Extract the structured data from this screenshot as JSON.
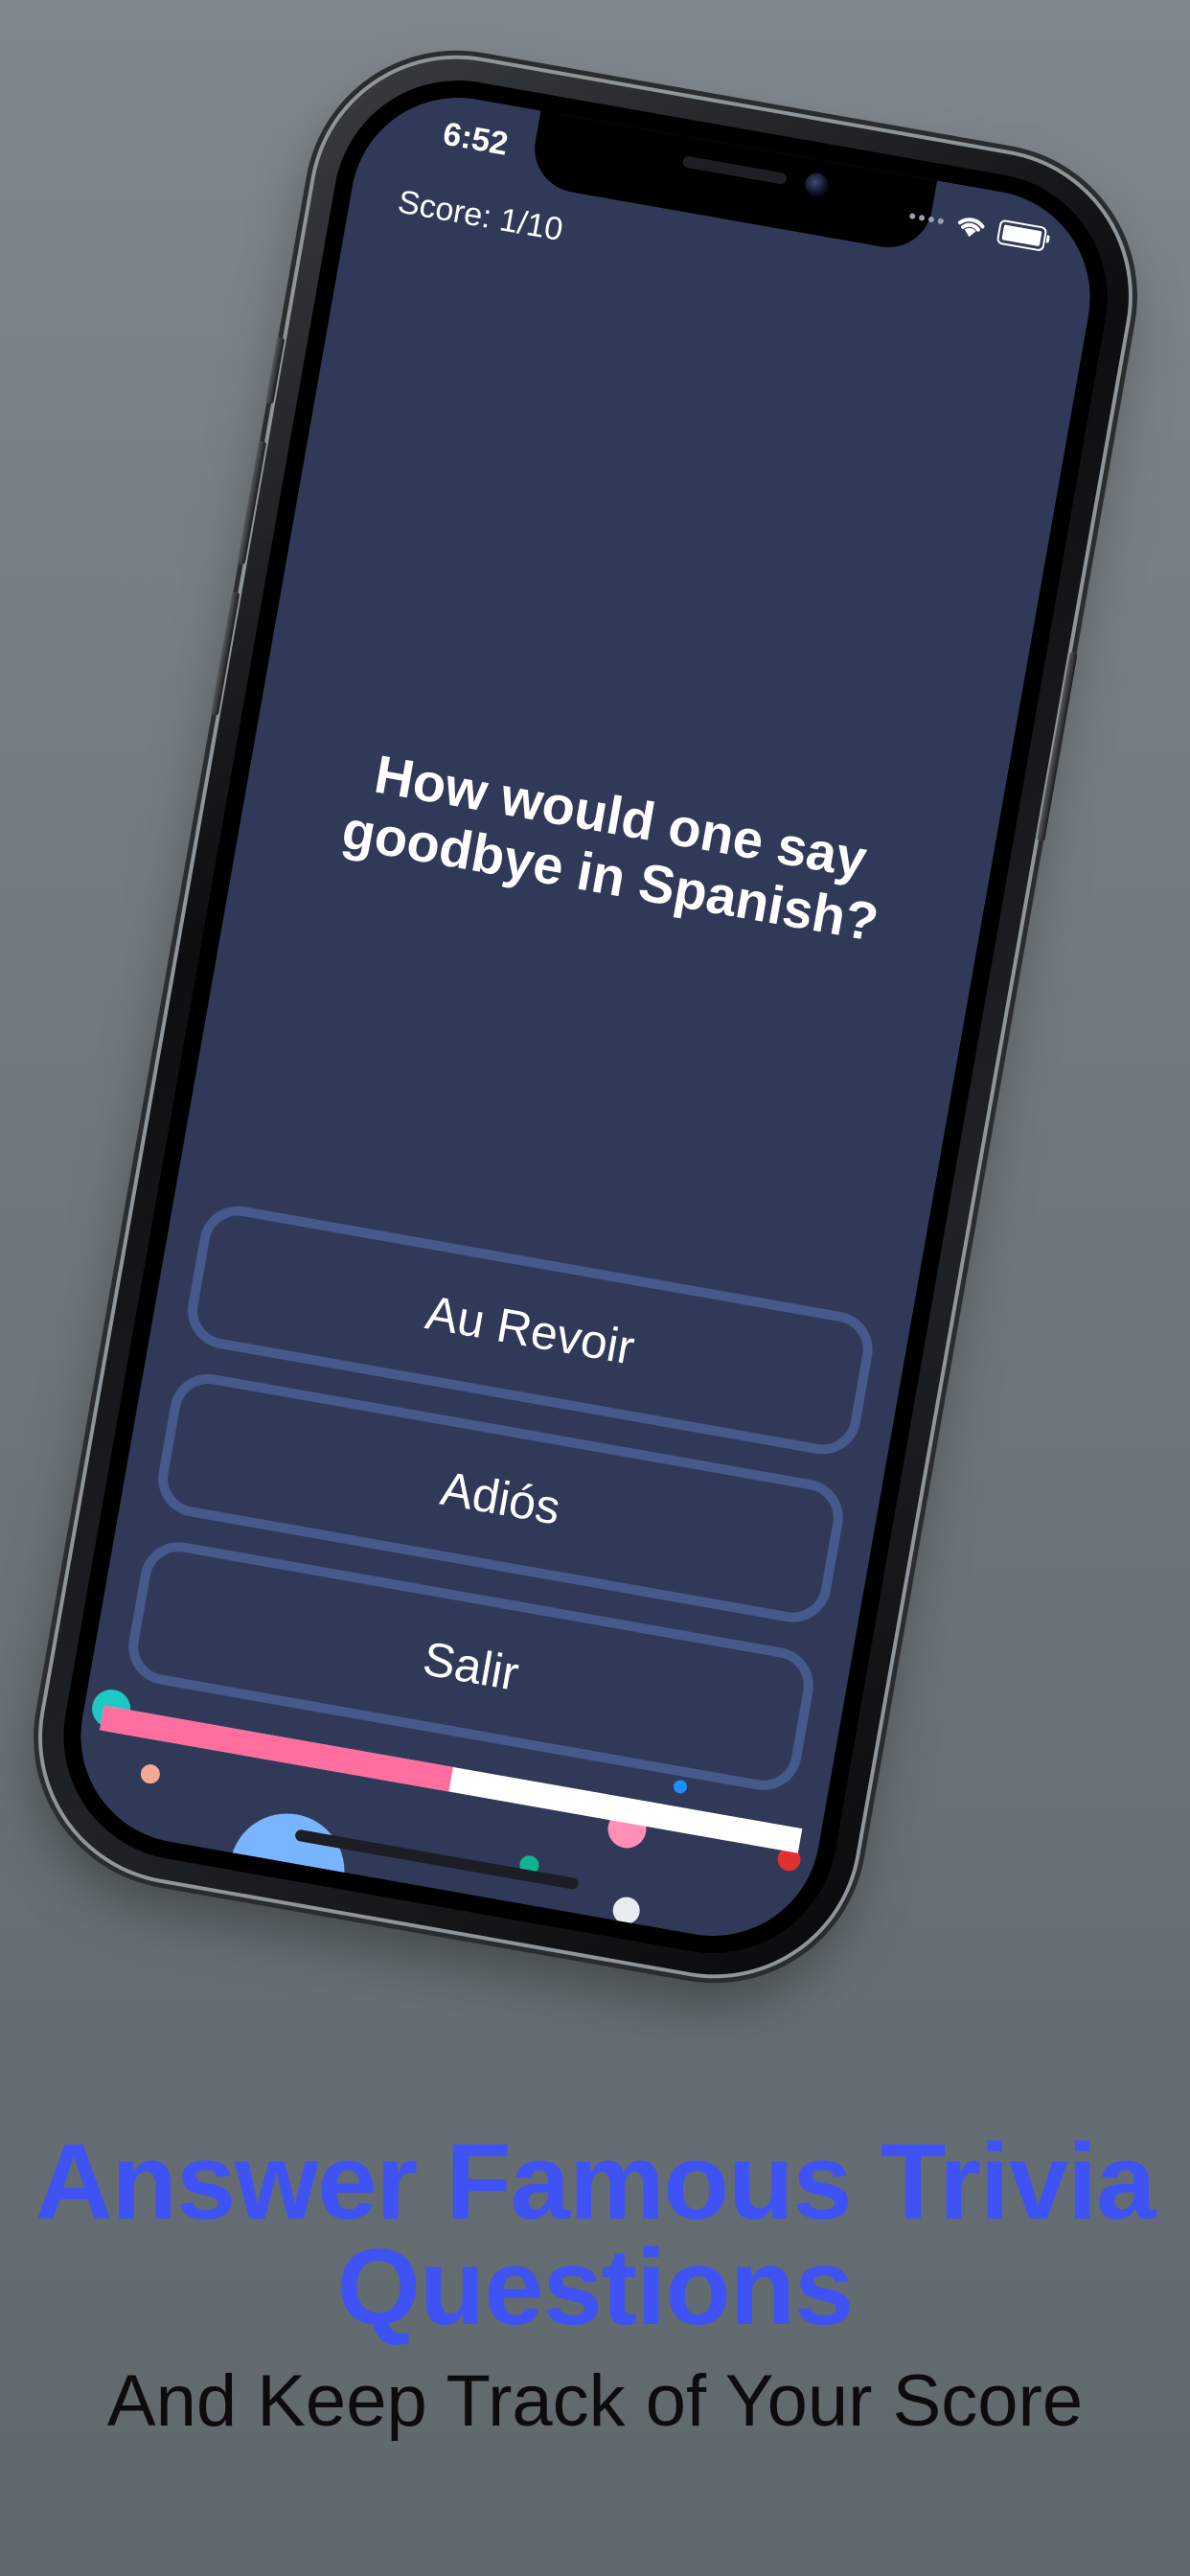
{
  "status_bar": {
    "time": "6:52",
    "icons": [
      "cellular-signal-icon",
      "wifi-icon",
      "battery-icon"
    ]
  },
  "game": {
    "score_label": "Score: 1/10",
    "question": "How would one say goodbye in Spanish?",
    "answers": [
      {
        "label": "Au Revoir"
      },
      {
        "label": "Adiós"
      },
      {
        "label": "Salir"
      }
    ],
    "progress_fraction": 0.5
  },
  "colors": {
    "screen_bg": "#303a58",
    "answer_border": "#46598c",
    "progress_fill": "#ff6e9f",
    "progress_track": "#ffffff",
    "headline": "#3f52f3",
    "subheadline": "#0c0c0e"
  },
  "marketing": {
    "headline": "Answer Famous Trivia Questions",
    "subheadline": "And Keep Track of Your Score"
  }
}
